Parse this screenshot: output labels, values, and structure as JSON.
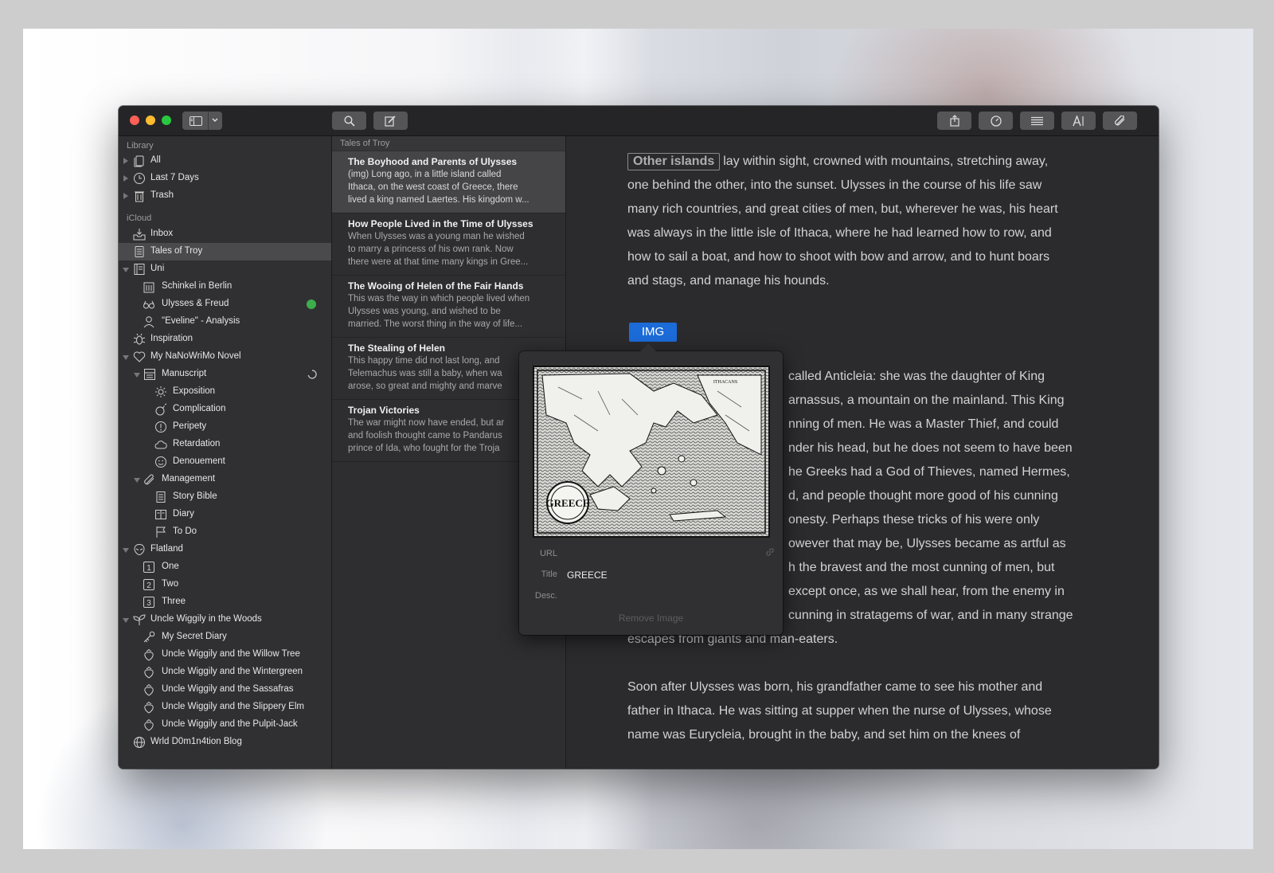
{
  "library": {
    "label": "Library",
    "items": [
      {
        "label": "All"
      },
      {
        "label": "Last 7 Days"
      },
      {
        "label": "Trash"
      }
    ]
  },
  "icloud": {
    "label": "iCloud",
    "items": [
      {
        "label": "Inbox"
      },
      {
        "label": "Tales of Troy"
      },
      {
        "label": "Uni"
      },
      {
        "label": "Schinkel in Berlin"
      },
      {
        "label": "Ulysses & Freud"
      },
      {
        "label": "\"Eveline\" - Analysis"
      },
      {
        "label": "Inspiration"
      },
      {
        "label": "My NaNoWriMo Novel"
      },
      {
        "label": "Manuscript"
      },
      {
        "label": "Exposition"
      },
      {
        "label": "Complication"
      },
      {
        "label": "Peripety"
      },
      {
        "label": "Retardation"
      },
      {
        "label": "Denouement"
      },
      {
        "label": "Management"
      },
      {
        "label": "Story Bible"
      },
      {
        "label": "Diary"
      },
      {
        "label": "To Do"
      },
      {
        "label": "Flatland"
      },
      {
        "label": "One"
      },
      {
        "label": "Two"
      },
      {
        "label": "Three"
      },
      {
        "label": "Uncle Wiggily in the Woods"
      },
      {
        "label": "My Secret Diary"
      },
      {
        "label": "Uncle Wiggily and the Willow Tree"
      },
      {
        "label": "Uncle Wiggily and the Wintergreen"
      },
      {
        "label": "Uncle Wiggily and the Sassafras"
      },
      {
        "label": "Uncle Wiggily and the Slippery Elm"
      },
      {
        "label": "Uncle Wiggily and the Pulpit-Jack"
      },
      {
        "label": "Wrld D0m1n4tion Blog"
      }
    ]
  },
  "sheet_list": {
    "header": "Tales of Troy",
    "sheets": [
      {
        "title": "The Boyhood and Parents of Ulysses",
        "lines": [
          "(img) Long ago, in a little island called",
          "Ithaca, on the west coast of Greece, there",
          "lived a king named Laertes. His kingdom w..."
        ]
      },
      {
        "title": "How People Lived in the Time of Ulysses",
        "lines": [
          "When Ulysses was a young man he wished",
          "to marry a princess of his own rank. Now",
          "there were at that time many kings in Gree..."
        ]
      },
      {
        "title": "The Wooing of Helen of the Fair Hands",
        "lines": [
          "This was the way in which people lived when",
          "Ulysses was young, and wished to be",
          "married. The worst thing in the way of life..."
        ]
      },
      {
        "title": "The Stealing of Helen",
        "lines": [
          "This happy time did not last long, and",
          "Telemachus was still a baby, when wa",
          "arose, so great and mighty and marve"
        ]
      },
      {
        "title": "Trojan Victories",
        "lines": [
          "The war might now have ended, but ar",
          "and foolish thought came to Pandarus",
          "prince of Ida, who fought for the Troja"
        ]
      }
    ]
  },
  "editor": {
    "tag_text": "Other islands",
    "para1": [
      "lay within sight, crowned with mountains, stretching away,",
      "one behind the other, into the sunset. Ulysses in the course of his life saw",
      "many rich countries, and great cities of men, but, wherever he was, his heart",
      "was always in the little isle of Ithaca, where he had learned how to row, and",
      "how to sail a boat, and how to shoot with bow and arrow, and to hunt boars",
      "and stags, and manage his hounds."
    ],
    "img_label": "IMG",
    "para2": [
      "called Anticleia: she was the daughter of King",
      "arnassus, a mountain on the mainland. This King",
      "nning of men. He was a Master Thief, and could",
      "nder his head, but he does not seem to have been",
      "he Greeks had a God of Thieves, named Hermes,",
      "d, and people thought more good of his cunning",
      "onesty. Perhaps these tricks of his were only",
      "owever that may be, Ulysses became as artful as",
      "h the bravest and the most cunning of men, but",
      "except once, as we shall hear, from the enemy in",
      "cunning in stratagems of war, and in many strange",
      "escapes from giants and man-eaters."
    ],
    "para3": [
      "Soon after Ulysses was born, his grandfather came to see his mother and",
      "father in Ithaca. He was sitting at supper when the nurse of Ulysses, whose",
      "name was Eurycleia, brought in the baby, and set him on the knees of"
    ]
  },
  "image_popover": {
    "map_caption": "GREECE",
    "map_corner_label": "ITHACANS",
    "url_label": "URL",
    "url_value": "",
    "title_label": "Title",
    "title_value": "GREECE",
    "desc_label": "Desc.",
    "desc_value": "",
    "remove_label": "Remove Image"
  },
  "colors": {
    "accent": "#1b6bd8",
    "sync_status": "#3cae4c"
  }
}
